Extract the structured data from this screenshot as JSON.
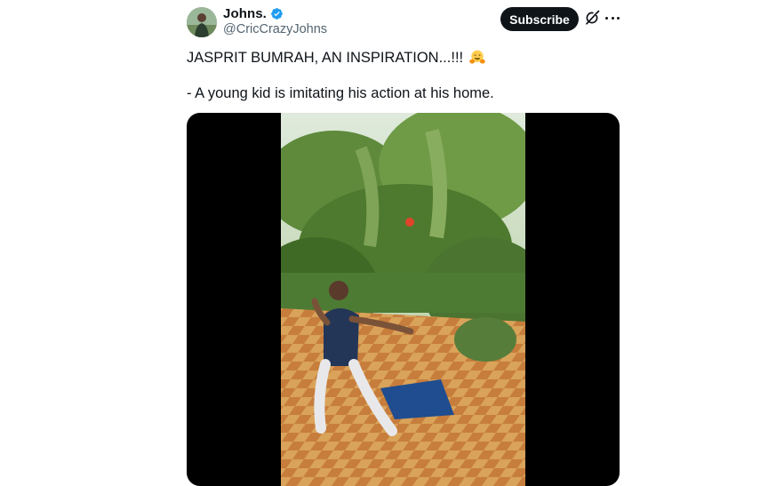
{
  "author": {
    "display_name": "Johns.",
    "handle": "@CricCrazyJohns",
    "verified_color": "#1d9bf0"
  },
  "actions": {
    "subscribe_label": "Subscribe",
    "grok_icon": "grok-icon",
    "more_icon": "more-icon"
  },
  "tweet": {
    "line1": "JASPRIT BUMRAH, AN INSPIRATION...!!!",
    "line1_emoji": "hugging-face-emoji",
    "line2": "- A young kid is imitating his action at his home."
  },
  "media": {
    "type": "video",
    "background": "#000000"
  }
}
